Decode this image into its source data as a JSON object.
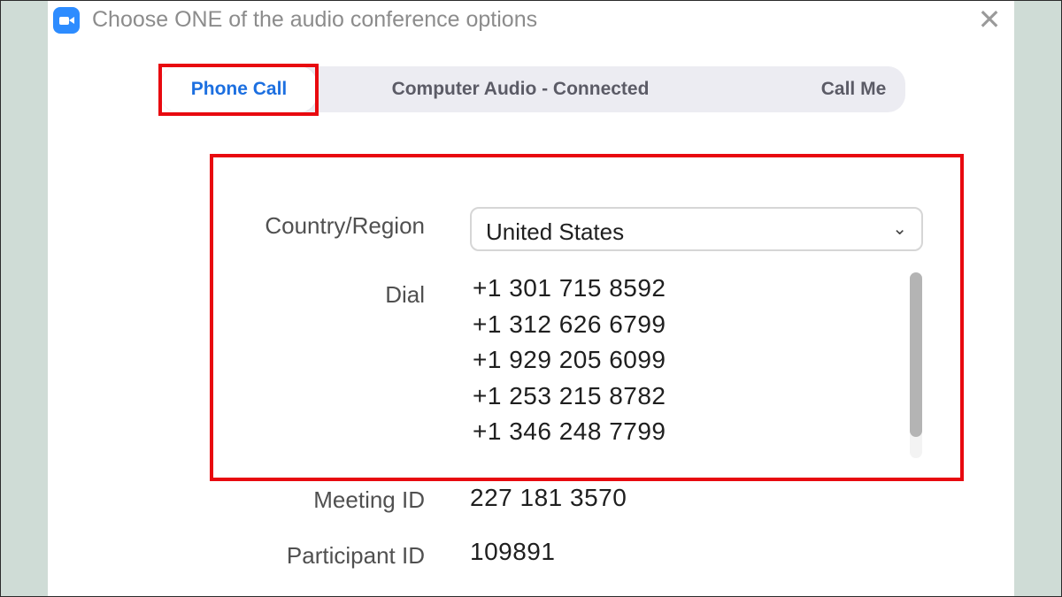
{
  "window": {
    "title": "Choose ONE of the audio conference options",
    "app_icon": "zoom-camera-icon",
    "close_icon": "close-icon",
    "close_glyph": "✕"
  },
  "tabs": [
    {
      "label": "Phone Call",
      "selected": true
    },
    {
      "label": "Computer Audio - Connected",
      "selected": false
    },
    {
      "label": "Call Me",
      "selected": false
    }
  ],
  "form": {
    "country_label": "Country/Region",
    "country_value": "United States",
    "dropdown_icon": "chevron-down-icon",
    "dropdown_glyph": "⌄",
    "dial_label": "Dial",
    "dial_numbers": [
      "+1 301 715 8592",
      "+1 312 626 6799",
      "+1 929 205 6099",
      "+1 253 215 8782",
      "+1 346 248 7799"
    ],
    "meeting_id_label": "Meeting ID",
    "meeting_id": "227 181 3570",
    "participant_id_label": "Participant ID",
    "participant_id": "109891"
  },
  "colors": {
    "accent": "#1c6fe0",
    "annotation": "#e8090f",
    "tab_bar": "#ececf2",
    "backdrop": "#cfdcd6"
  }
}
